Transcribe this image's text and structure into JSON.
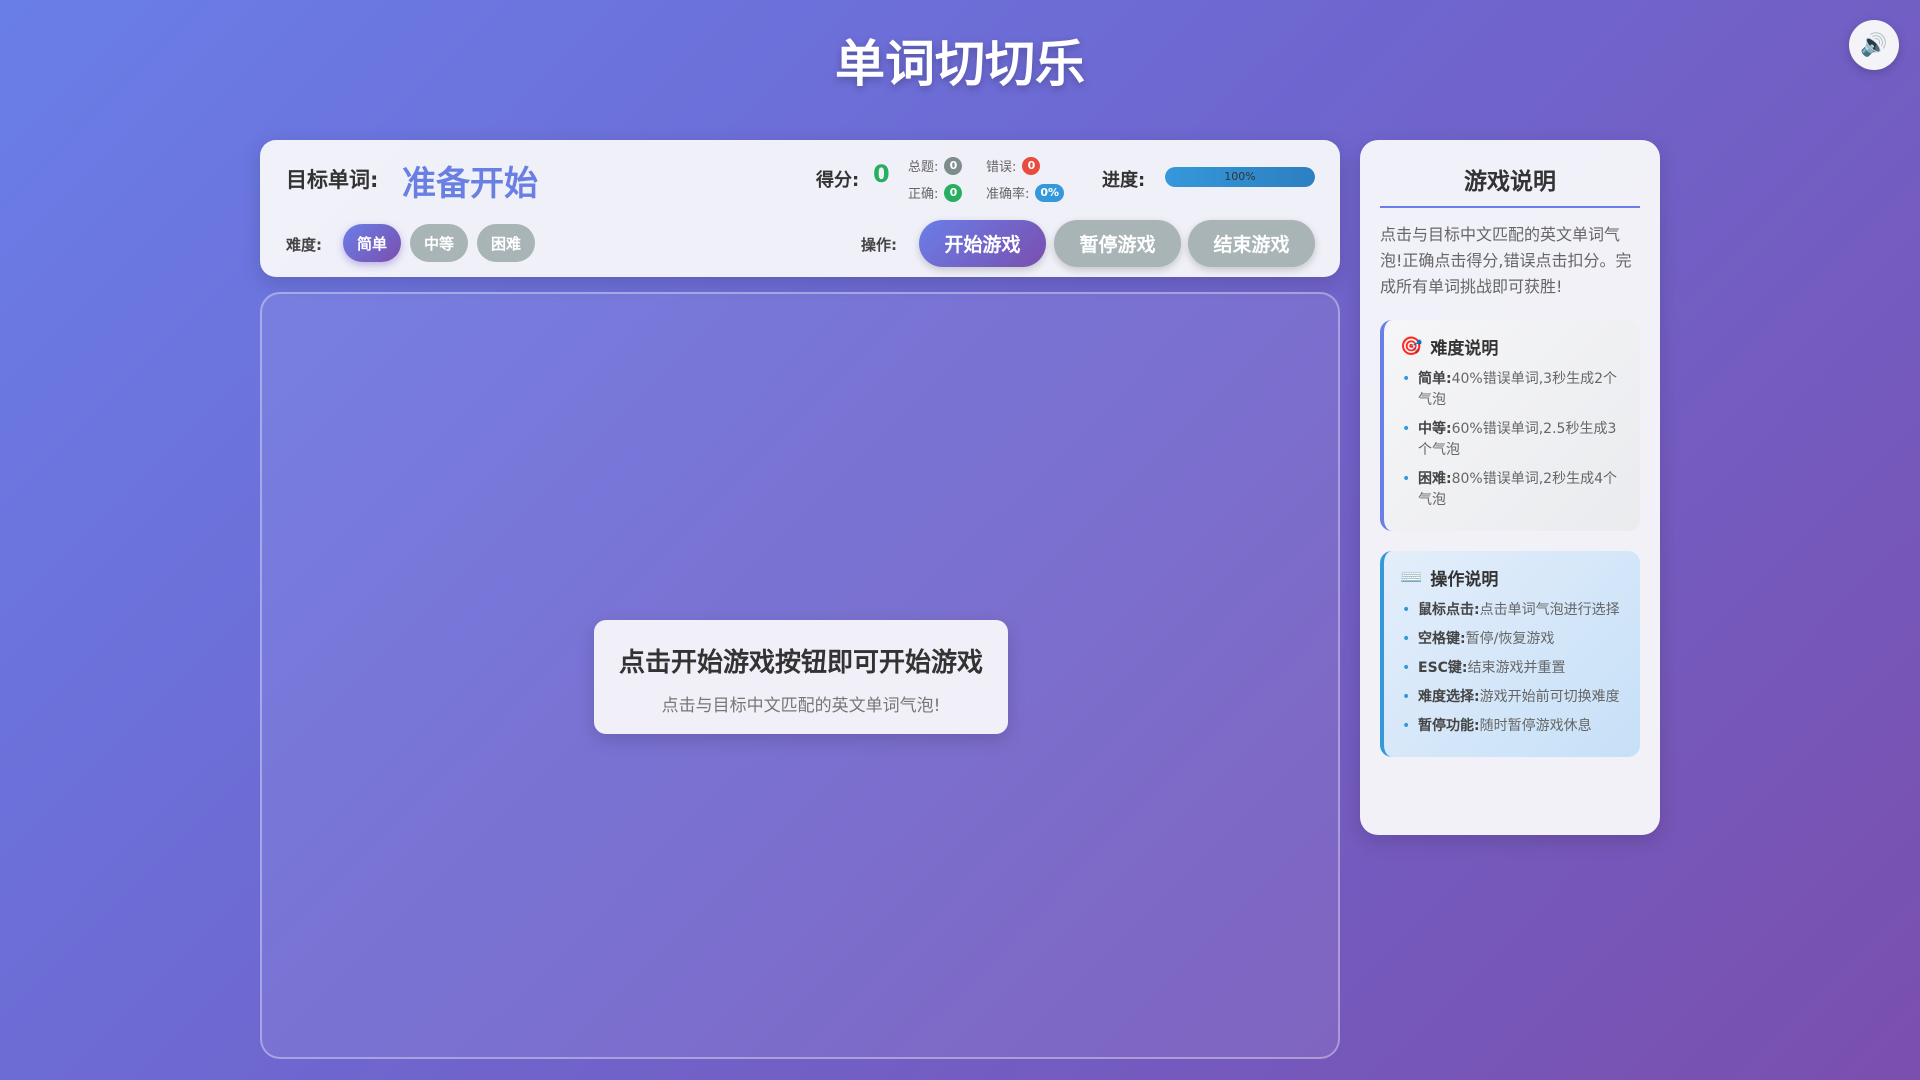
{
  "app": {
    "title": "单词切切乐"
  },
  "sound": {
    "icon": "speaker-icon"
  },
  "control": {
    "target_label": "目标单词:",
    "target_word": "准备开始",
    "score_label": "得分:",
    "score_value": "0",
    "stats": {
      "total_label": "总题:",
      "total_value": "0",
      "wrong_label": "错误:",
      "wrong_value": "0",
      "correct_label": "正确:",
      "correct_value": "0",
      "accuracy_label": "准确率:",
      "accuracy_value": "0%"
    },
    "progress_label": "进度:",
    "progress_text": "100%",
    "progress_fraction": 1.0,
    "difficulty_label": "难度:",
    "difficulty_options": [
      "简单",
      "中等",
      "困难"
    ],
    "difficulty_selected": "简单",
    "ops_label": "操作:",
    "ops": {
      "start": "开始游戏",
      "pause": "暂停游戏",
      "end": "结束游戏"
    }
  },
  "game": {
    "prompt_title": "点击开始游戏按钮即可开始游戏",
    "prompt_sub": "点击与目标中文匹配的英文单词气泡!"
  },
  "help": {
    "title": "游戏说明",
    "intro": "点击与目标中文匹配的英文单词气泡!正确点击得分,错误点击扣分。完成所有单词挑战即可获胜!",
    "difficulty_box": {
      "icon": "target-icon",
      "title": "难度说明",
      "items": [
        {
          "key": "简单:",
          "text": "40%错误单词,3秒生成2个气泡"
        },
        {
          "key": "中等:",
          "text": "60%错误单词,2.5秒生成3个气泡"
        },
        {
          "key": "困难:",
          "text": "80%错误单词,2秒生成4个气泡"
        }
      ]
    },
    "ops_box": {
      "icon": "keyboard-icon",
      "title": "操作说明",
      "items": [
        {
          "key": "鼠标点击:",
          "text": "点击单词气泡进行选择"
        },
        {
          "key": "空格键:",
          "text": "暂停/恢复游戏"
        },
        {
          "key": "ESC键:",
          "text": "结束游戏并重置"
        },
        {
          "key": "难度选择:",
          "text": "游戏开始前可切换难度"
        },
        {
          "key": "暂停功能:",
          "text": "随时暂停游戏休息"
        }
      ]
    }
  },
  "colors": {
    "accent": "#6a7ee8",
    "score_green": "#27ae60",
    "wrong_red": "#e74c3c",
    "total_grey": "#7f8c8d",
    "accuracy_blue": "#3498db"
  }
}
